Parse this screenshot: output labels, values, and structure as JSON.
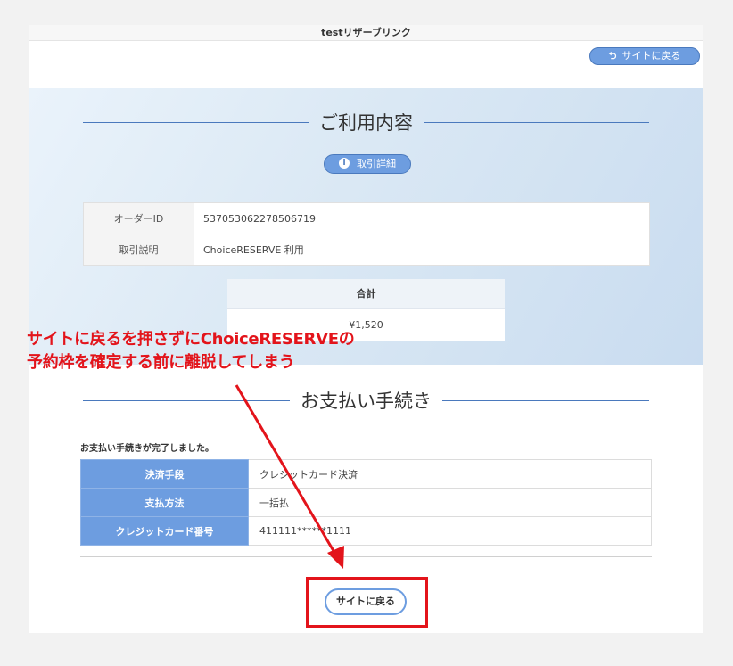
{
  "window": {
    "title": "testリザーブリンク"
  },
  "header": {
    "back_label": "サイトに戻る",
    "back_icon": "return-arrow-icon"
  },
  "usage": {
    "heading": "ご利用内容",
    "detail_button": "取引詳細",
    "rows": [
      {
        "label": "オーダーID",
        "value": "537053062278506719"
      },
      {
        "label": "取引説明",
        "value": "ChoiceRESERVE 利用"
      }
    ],
    "total_label": "合計",
    "total_value": "¥1,520"
  },
  "payment": {
    "heading": "お支払い手続き",
    "complete_message": "お支払い手続きが完了しました。",
    "rows": [
      {
        "label": "決済手段",
        "value": "クレジットカード決済"
      },
      {
        "label": "支払方法",
        "value": "一括払"
      },
      {
        "label": "クレジットカード番号",
        "value": "411111******1111"
      }
    ]
  },
  "footer": {
    "back_label": "サイトに戻る"
  },
  "annotation": {
    "line1": "サイトに戻るを押さずにChoiceRESERVEの",
    "line2": "予約枠を確定する前に離脱してしまう",
    "color": "#e3141b"
  },
  "colors": {
    "accent": "#6d9de0",
    "accent_dark": "#4a79bd",
    "annotation_red": "#e3141b"
  }
}
